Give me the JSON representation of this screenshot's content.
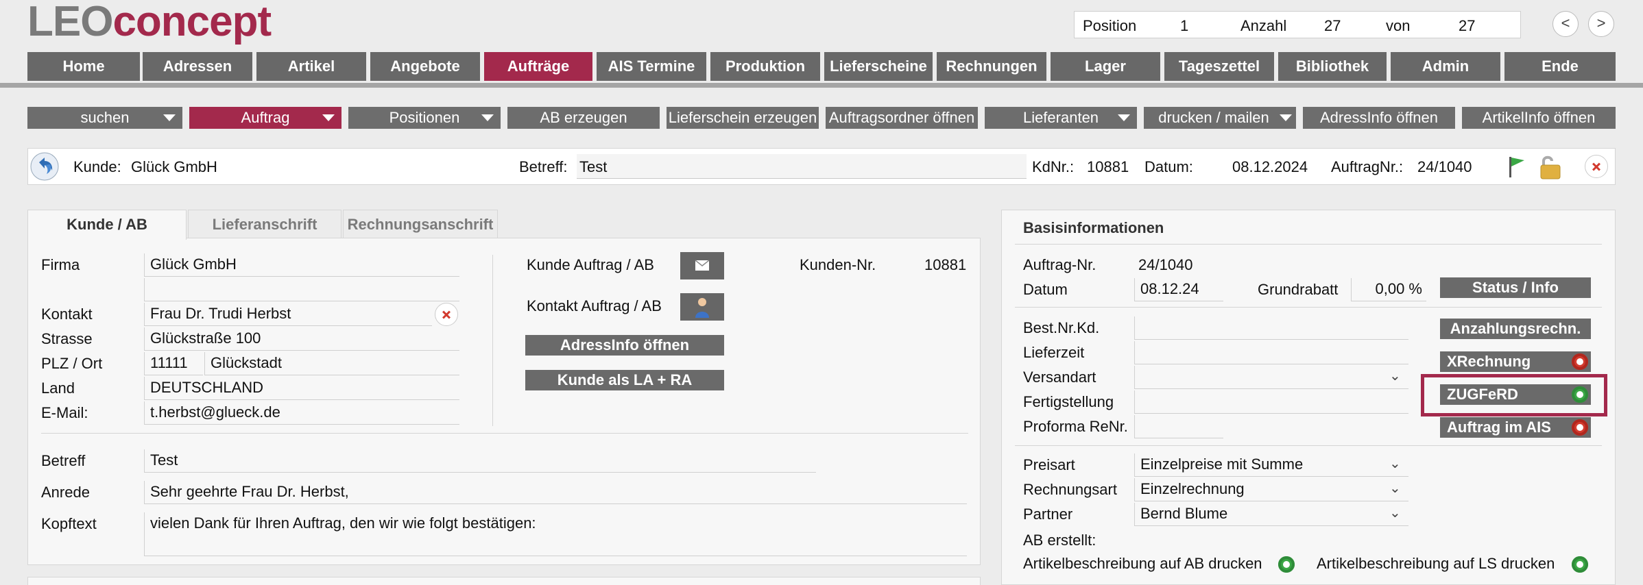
{
  "logo": {
    "part1": "LEO",
    "part2": "concept"
  },
  "position": {
    "pos_label": "Position",
    "pos_value": "1",
    "count_label": "Anzahl",
    "count_value": "27",
    "of_label": "von",
    "of_value": "27",
    "prev": "<",
    "next": ">"
  },
  "main_nav": [
    "Home",
    "Adressen",
    "Artikel",
    "Angebote",
    "Aufträge",
    "AIS Termine",
    "Produktion",
    "Lieferscheine",
    "Rechnungen",
    "Lager",
    "Tageszettel",
    "Bibliothek",
    "Admin",
    "Ende"
  ],
  "sub_nav": [
    "suchen",
    "Auftrag",
    "Positionen",
    "AB erzeugen",
    "Lieferschein erzeugen",
    "Auftragsordner öffnen",
    "Lieferanten",
    "drucken / mailen",
    "AdressInfo öffnen",
    "ArtikelInfo öffnen"
  ],
  "record": {
    "kunde_label": "Kunde:",
    "kunde_value": "Glück GmbH",
    "betreff_label": "Betreff:",
    "betreff_value": "Test",
    "kdnr_label": "KdNr.:",
    "kdnr_value": "10881",
    "datum_label": "Datum:",
    "datum_value": "08.12.2024",
    "auftragnr_label": "AuftragNr.:",
    "auftragnr_value": "24/1040"
  },
  "tabs": [
    "Kunde / AB",
    "Lieferanschrift",
    "Rechnungsanschrift"
  ],
  "customer": {
    "firma_label": "Firma",
    "firma": "Glück GmbH",
    "kontakt_label": "Kontakt",
    "kontakt": "Frau Dr. Trudi Herbst",
    "strasse_label": "Strasse",
    "strasse": "Glückstraße 100",
    "plz_label": "PLZ / Ort",
    "plz": "11111",
    "ort": "Glückstadt",
    "land_label": "Land",
    "land": "DEUTSCHLAND",
    "email_label": "E-Mail:",
    "email": "t.herbst@glueck.de",
    "kunde_auftrag_label": "Kunde Auftrag / AB",
    "kontakt_auftrag_label": "Kontakt Auftrag / AB",
    "adressinfo_btn": "AdressInfo öffnen",
    "kunde_la_ra_btn": "Kunde als LA + RA",
    "kundennr_label": "Kunden-Nr.",
    "kundennr": "10881",
    "betreff_label": "Betreff",
    "betreff": "Test",
    "anrede_label": "Anrede",
    "anrede": "Sehr geehrte Frau Dr. Herbst,",
    "kopftext_label": "Kopftext",
    "kopftext": "vielen Dank für Ihren Auftrag, den wir wie folgt bestätigen:"
  },
  "basis": {
    "title": "Basisinformationen",
    "auftragnr_label": "Auftrag-Nr.",
    "auftragnr": "24/1040",
    "datum_label": "Datum",
    "datum": "08.12.24",
    "grundrabatt_label": "Grundrabatt",
    "grundrabatt": "0,00 %",
    "status_btn": "Status / Info",
    "bestnr_label": "Best.Nr.Kd.",
    "lieferzeit_label": "Lieferzeit",
    "versandart_label": "Versandart",
    "fertigstellung_label": "Fertigstellung",
    "proforma_label": "Proforma ReNr.",
    "anzahlung_btn": "Anzahlungsrechn.",
    "xrechnung_btn": "XRechnung",
    "zugferd_btn": "ZUGFeRD",
    "ais_btn": "Auftrag im AIS",
    "preisart_label": "Preisart",
    "preisart": "Einzelpreise mit Summe",
    "rechnungsart_label": "Rechnungsart",
    "rechnungsart": "Einzelrechnung",
    "partner_label": "Partner",
    "partner": "Bernd Blume",
    "ab_erstellt_label": "AB erstellt:",
    "artbeschr_ab_label": "Artikelbeschreibung auf AB drucken",
    "artbeschr_ls_label": "Artikelbeschreibung auf LS drucken"
  },
  "colors": {
    "accent": "#a3294c",
    "button_gray": "#686868",
    "status_green": "#3aa745",
    "status_red": "#d23a2e"
  }
}
